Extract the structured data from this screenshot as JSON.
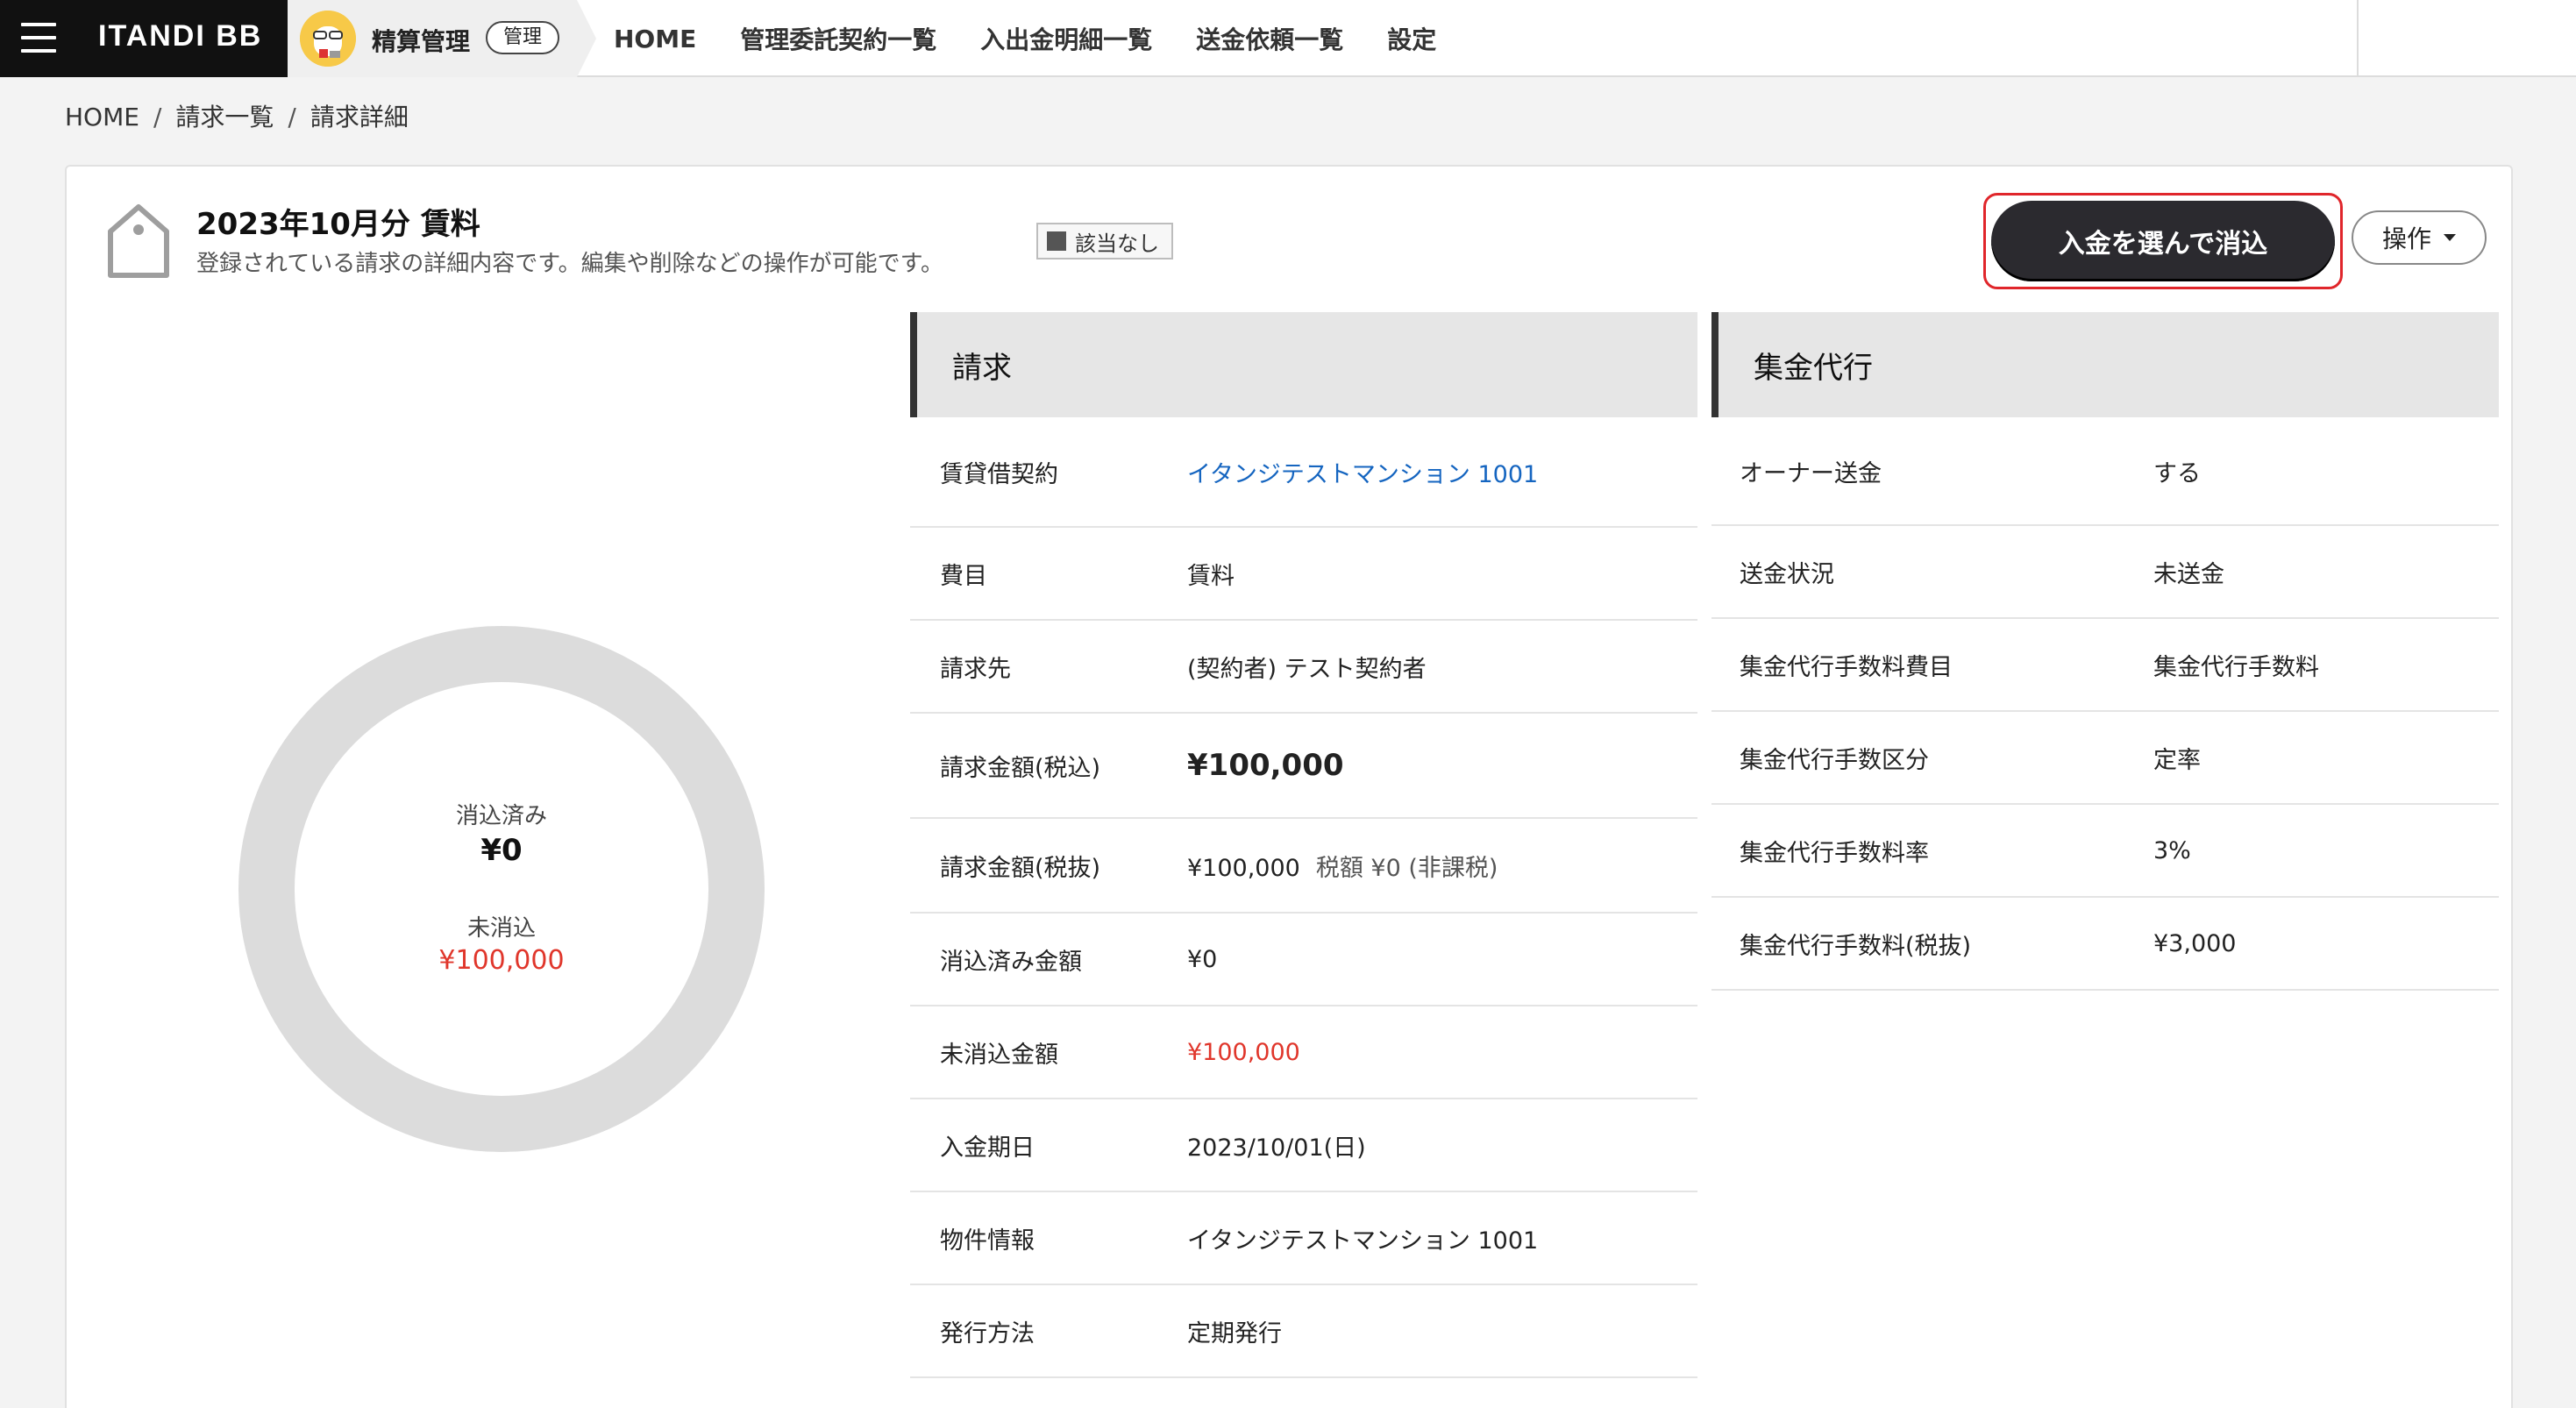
{
  "brand": {
    "name": "ITANDI BB"
  },
  "app": {
    "name": "精算管理",
    "badge": "管理"
  },
  "nav": [
    "HOME",
    "管理委託契約一覧",
    "入出金明細一覧",
    "送金依頼一覧",
    "設定"
  ],
  "breadcrumb": [
    "HOME",
    "請求一覧",
    "請求詳細"
  ],
  "card": {
    "title": "2023年10月分 賃料",
    "description": "登録されている請求の詳細内容です。編集や削除などの操作が可能です。",
    "tag": "該当なし",
    "primary_button": "入金を選んで消込",
    "ops_button": "操作"
  },
  "donut": {
    "cleared_label": "消込済み",
    "cleared_value": "¥0",
    "uncleared_label": "未消込",
    "uncleared_value": "¥100,000",
    "cleared_fraction": 0
  },
  "billing": {
    "title": "請求",
    "rows": [
      {
        "key": "賃貸借契約",
        "value": "イタンジテストマンション 1001"
      },
      {
        "key": "費目",
        "value": "賃料"
      },
      {
        "key": "請求先",
        "value": "(契約者) テスト契約者"
      },
      {
        "key": "請求金額(税込)",
        "value": "¥100,000"
      },
      {
        "key": "請求金額(税抜)",
        "value": "¥100,000",
        "extra": "税額 ¥0 (非課税)"
      },
      {
        "key": "消込済み金額",
        "value": "¥0"
      },
      {
        "key": "未消込金額",
        "value": "¥100,000"
      },
      {
        "key": "入金期日",
        "value": "2023/10/01(日)"
      },
      {
        "key": "物件情報",
        "value": "イタンジテストマンション 1001"
      },
      {
        "key": "発行方法",
        "value": "定期発行"
      }
    ]
  },
  "agency": {
    "title": "集金代行",
    "rows": [
      {
        "key": "オーナー送金",
        "value": "する"
      },
      {
        "key": "送金状況",
        "value": "未送金"
      },
      {
        "key": "集金代行手数料費目",
        "value": "集金代行手数料"
      },
      {
        "key": "集金代行手数区分",
        "value": "定率"
      },
      {
        "key": "集金代行手数料率",
        "value": "3%"
      },
      {
        "key": "集金代行手数料(税抜)",
        "value": "¥3,000"
      }
    ]
  },
  "colors": {
    "accent": "#e0262b",
    "link": "#1565c0",
    "uncleared": "#e0362b"
  }
}
